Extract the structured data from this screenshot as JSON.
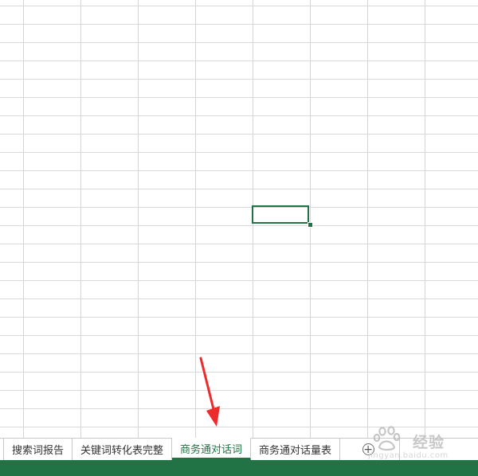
{
  "app": "Microsoft Excel",
  "sheet_tabs": [
    {
      "label": "搜索词报告",
      "active": false
    },
    {
      "label": "关键词转化表完整",
      "active": false
    },
    {
      "label": "商务通对话词",
      "active": true
    },
    {
      "label": "商务通对话量表",
      "active": false
    }
  ],
  "add_sheet_symbol": "+",
  "annotation": {
    "type": "red-arrow",
    "points_to": "商务通对话词",
    "color": "#ee2b2b"
  },
  "watermark": {
    "brand_text": "经验",
    "url_text": "jingyan.baidu.com"
  },
  "colors": {
    "accent": "#217346",
    "gridline": "#d9d9d9",
    "tab_border": "#c8c8c8",
    "arrow": "#ee2b2b"
  },
  "icons": {
    "add_sheet": "plus-circle-icon",
    "annotation": "red-arrow-icon",
    "watermark_logo": "baidu-paw-icon"
  }
}
